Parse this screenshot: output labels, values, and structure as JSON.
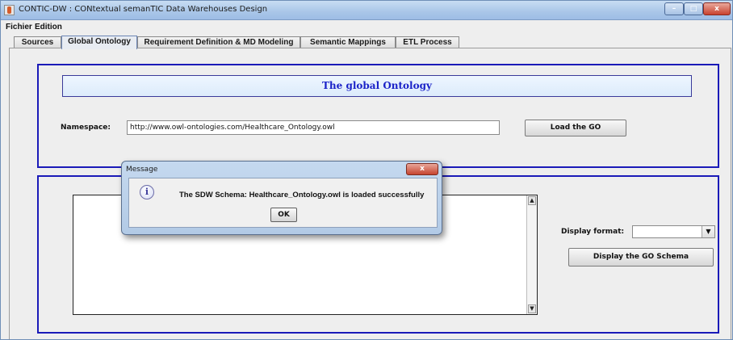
{
  "window": {
    "title": "CONTIC-DW : CONtextual semanTIC Data Warehouses Design",
    "min_glyph": "–",
    "max_glyph": "□",
    "close_glyph": "x"
  },
  "menubar": {
    "items": [
      "Fichier",
      "Edition"
    ]
  },
  "tabs": [
    {
      "label": "Sources",
      "active": false
    },
    {
      "label": "Global Ontology",
      "active": true
    },
    {
      "label": "Requirement Definition & MD Modeling",
      "active": false
    },
    {
      "label": "Semantic Mappings",
      "active": false
    },
    {
      "label": "ETL Process",
      "active": false
    }
  ],
  "global_ontology": {
    "header_title": "The global Ontology",
    "namespace_label": "Namespace:",
    "namespace_value": "http://www.owl-ontologies.com/Healthcare_Ontology.owl",
    "load_button": "Load the GO",
    "display_format_label": "Display format:",
    "display_format_value": "",
    "display_button": "Display the GO Schema"
  },
  "dialog": {
    "title": "Message",
    "close_glyph": "x",
    "message": "The SDW Schema: Healthcare_Ontology.owl is loaded successfully",
    "ok_button": "OK",
    "icon": "info-icon"
  },
  "colors": {
    "panel_border": "#1a1ab8",
    "header_text": "#1a22c8",
    "titlebar": "#a9c6e8"
  }
}
